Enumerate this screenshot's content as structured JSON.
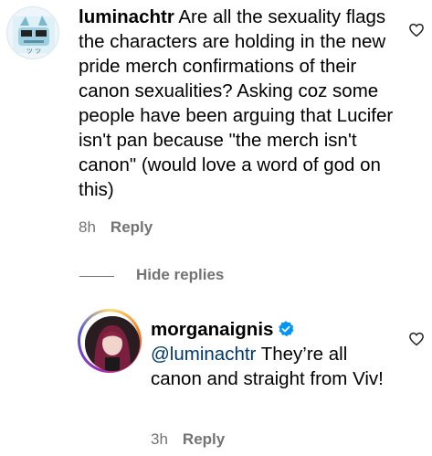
{
  "comment": {
    "username": "luminachtr",
    "text": "Are all the sexuality flags the characters are holding in the new pride merch confirmations of their canon sexualities? Asking coz some people have been arguing that Lucifer isn't pan because \"the merch isn't canon\" (would love a word of god on this)",
    "time": "8h",
    "reply_label": "Reply",
    "like_icon": "heart-outline-icon"
  },
  "thread": {
    "toggle_label": "Hide replies"
  },
  "reply": {
    "username": "morganaignis",
    "verified": true,
    "mention": "@luminachtr",
    "text": "They’re all canon and straight from Viv!",
    "time": "3h",
    "reply_label": "Reply",
    "like_icon": "heart-outline-icon"
  },
  "colors": {
    "meta_gray": "#737373",
    "mention_blue": "#00376b",
    "verified_blue": "#0095f6"
  }
}
